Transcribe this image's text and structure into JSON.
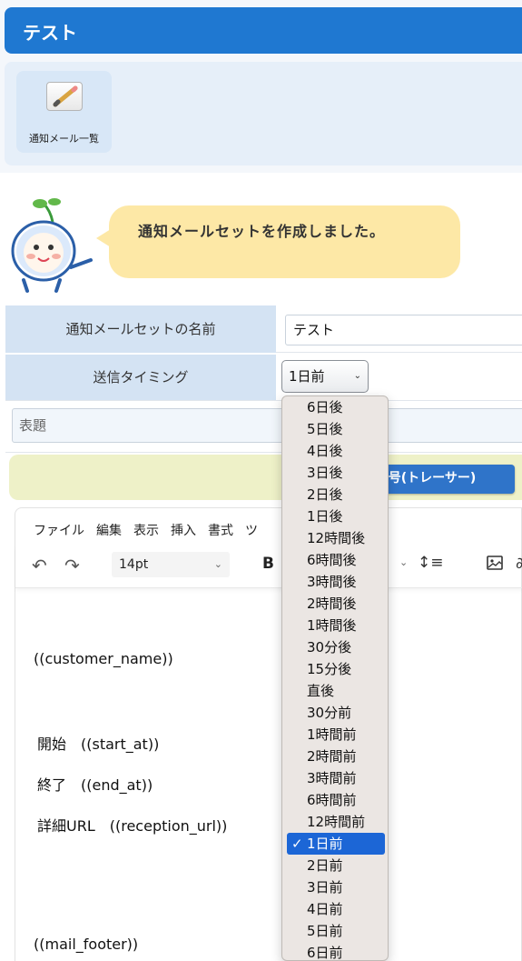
{
  "header": {
    "title": "テスト"
  },
  "toolbar": {
    "mail_list_label": "通知メール一覧"
  },
  "message": {
    "text": "通知メールセットを作成しました。"
  },
  "form": {
    "name_label": "通知メールセットの名前",
    "name_value": "テスト",
    "timing_label": "送信タイミング",
    "timing_value": "1日前",
    "subject_placeholder": "表題",
    "tracer_button_label": "号(トレーサー)"
  },
  "editor": {
    "menu": [
      "ファイル",
      "編集",
      "表示",
      "挿入",
      "書式",
      "ツ"
    ],
    "font_size": "14pt",
    "bold_label": "B",
    "body_lines": [
      "((customer_name))",
      "開始　((start_at))",
      "終了　((end_at))",
      "詳細URL　((reception_url))",
      "((mail_footer))"
    ]
  },
  "timing_options": [
    "6日後",
    "5日後",
    "4日後",
    "3日後",
    "2日後",
    "1日後",
    "12時間後",
    "6時間後",
    "3時間後",
    "2時間後",
    "1時間後",
    "30分後",
    "15分後",
    "直後",
    "30分前",
    "1時間前",
    "2時間前",
    "3時間前",
    "6時間前",
    "12時間前",
    "1日前",
    "2日前",
    "3日前",
    "4日前",
    "5日前",
    "6日前"
  ],
  "selected_option": "1日前",
  "colors": {
    "header": "#1f78d1",
    "selected": "#1c66d6",
    "label_bg": "#d4e3f3",
    "bubble": "#fde8a6"
  }
}
